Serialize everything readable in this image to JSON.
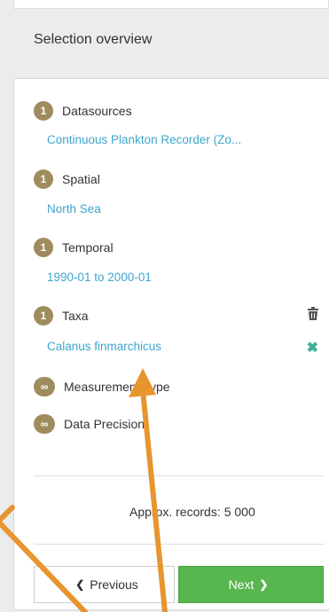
{
  "header": {
    "title": "Selection overview"
  },
  "sections": [
    {
      "badge": "1",
      "label": "Datasources",
      "value": "Continuous Plankton Recorder (Zo..."
    },
    {
      "badge": "1",
      "label": "Spatial",
      "value": "North Sea"
    },
    {
      "badge": "1",
      "label": "Temporal",
      "value": "1990-01 to 2000-01"
    },
    {
      "badge": "1",
      "label": "Taxa",
      "value": "Calanus finmarchicus"
    },
    {
      "badge": "∞",
      "label": "Measurement Type"
    },
    {
      "badge": "∞",
      "label": "Data Precision"
    }
  ],
  "records": {
    "label": "Approx. records:",
    "value": "5 000"
  },
  "buttons": {
    "previous": "Previous",
    "next": "Next"
  },
  "colors": {
    "badge": "#9f8c5e",
    "link": "#3ea6cf",
    "next_button": "#57b64f",
    "annotation_arrow": "#e8952f"
  }
}
